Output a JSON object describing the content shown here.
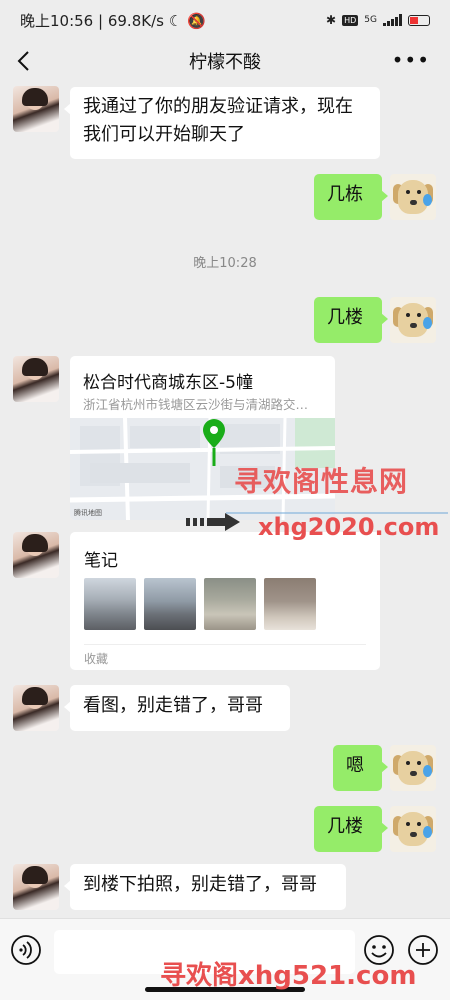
{
  "statusbar": {
    "time": "晚上10:56",
    "speed": "69.8K/s",
    "network": "5G",
    "hd": "HD",
    "battery": "39"
  },
  "header": {
    "title": "柠檬不酸"
  },
  "messages": [
    {
      "side": "left",
      "text_line1": "我通过了你的朋友验证请求，现在",
      "text_line2": "我们可以开始聊天了"
    },
    {
      "side": "right",
      "text": "几栋"
    },
    {
      "side": "right",
      "text": "几楼"
    },
    {
      "side": "left",
      "text": "看图，别走错了，哥哥"
    },
    {
      "side": "right",
      "text": "嗯"
    },
    {
      "side": "right",
      "text": "几楼"
    },
    {
      "side": "left",
      "text": "到楼下拍照，别走错了，哥哥"
    }
  ],
  "timestamp": "晚上10:28",
  "location_card": {
    "title": "松合时代商城东区-5幢",
    "address": "浙江省杭州市钱塘区云沙街与清湖路交…",
    "map_provider": "腾讯地图"
  },
  "note_card": {
    "title": "笔记",
    "footer": "收藏"
  },
  "watermarks": {
    "line1": "寻欢阁性息网",
    "line2": "xhg2020.com",
    "line3": "寻欢阁xhg521.com"
  },
  "colors": {
    "green_bubble": "#95ec69",
    "background": "#ededed",
    "watermark": "#e84f4f",
    "map_pin": "#1aad19"
  }
}
